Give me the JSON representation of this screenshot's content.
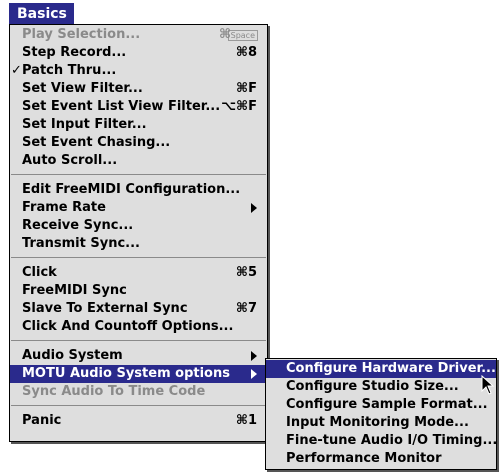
{
  "menubar": {
    "title": "Basics"
  },
  "menu": {
    "items": [
      {
        "label": "Play Selection...",
        "shortcut": "⌘",
        "shortcut_box": "Space"
      },
      {
        "label": "Step Record...",
        "shortcut": "⌘8"
      },
      {
        "label": "Patch Thru...",
        "checkmark": "✓"
      },
      {
        "label": "Set View Filter...",
        "shortcut": "⌘F"
      },
      {
        "label": "Set Event List View Filter...",
        "shortcut": "⌥⌘F"
      },
      {
        "label": "Set Input Filter..."
      },
      {
        "label": "Set Event Chasing..."
      },
      {
        "label": "Auto Scroll..."
      },
      {
        "label": "Edit FreeMIDI Configuration..."
      },
      {
        "label": "Frame Rate"
      },
      {
        "label": "Receive Sync..."
      },
      {
        "label": "Transmit Sync..."
      },
      {
        "label": "Click",
        "shortcut": "⌘5"
      },
      {
        "label": "FreeMIDI Sync"
      },
      {
        "label": "Slave To External Sync",
        "shortcut": "⌘7"
      },
      {
        "label": "Click And Countoff Options..."
      },
      {
        "label": "Audio System"
      },
      {
        "label": "MOTU Audio System options"
      },
      {
        "label": "Sync Audio To Time Code"
      },
      {
        "label": "Panic",
        "shortcut": "⌘1"
      }
    ]
  },
  "submenu": {
    "items": [
      {
        "label": "Configure Hardware Driver..."
      },
      {
        "label": "Configure Studio Size..."
      },
      {
        "label": "Configure Sample Format..."
      },
      {
        "label": "Input Monitoring Mode..."
      },
      {
        "label": "Fine-tune Audio I/O Timing..."
      },
      {
        "label": "Performance Monitor"
      }
    ]
  },
  "colors": {
    "highlight": "#2a2a8c",
    "menu_bg": "#dedede",
    "disabled": "#8a8a8a"
  }
}
